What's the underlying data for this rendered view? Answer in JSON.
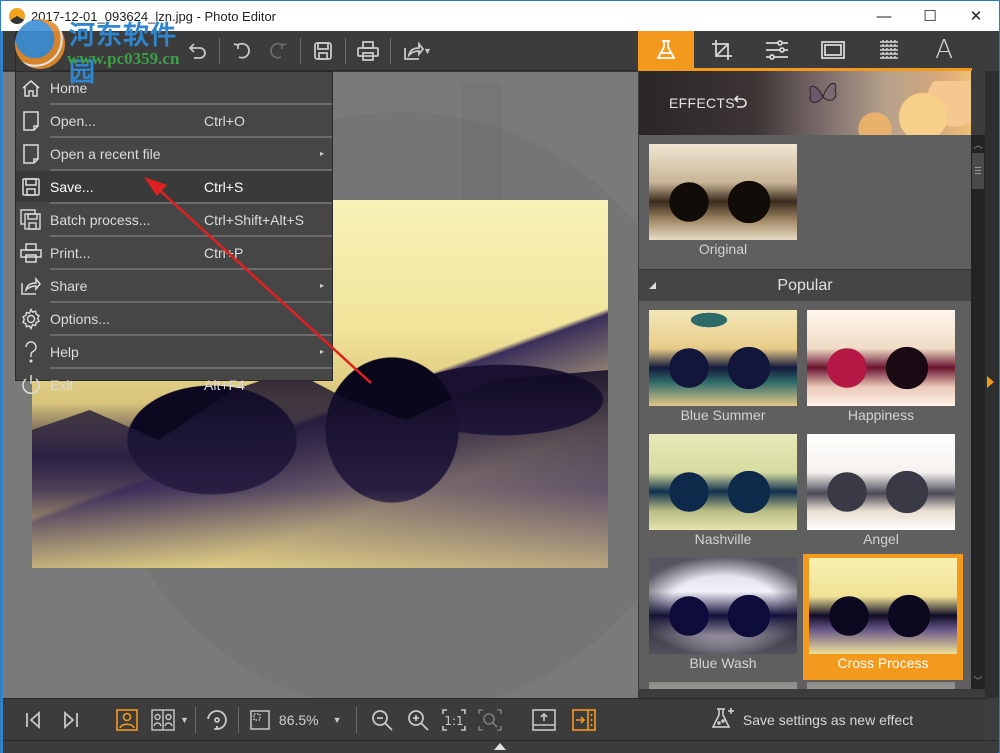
{
  "window": {
    "title": "2017-12-01_093624_lzn.jpg - Photo Editor",
    "controls": {
      "minimize": "—",
      "maximize": "☐",
      "close": "✕"
    }
  },
  "watermark": {
    "text_cn": "河东软件园",
    "url": "www.pc0359.cn"
  },
  "toolbar": {
    "icons": [
      "app-menu-icon",
      "back-icon",
      "undo-icon",
      "redo-icon",
      "save-icon",
      "print-icon",
      "share-icon"
    ]
  },
  "file_menu": {
    "items": [
      {
        "label": "Home",
        "shortcut": "",
        "icon": "home-icon",
        "submenu": false
      },
      {
        "label": "Open...",
        "shortcut": "Ctrl+O",
        "icon": "file-icon",
        "submenu": false
      },
      {
        "label": "Open a recent file",
        "shortcut": "",
        "icon": "file-icon",
        "submenu": true
      },
      {
        "label": "Save...",
        "shortcut": "Ctrl+S",
        "icon": "save-icon",
        "submenu": false,
        "highlighted": true
      },
      {
        "label": "Batch process...",
        "shortcut": "Ctrl+Shift+Alt+S",
        "icon": "batch-save-icon",
        "submenu": false
      },
      {
        "label": "Print...",
        "shortcut": "Ctrl+P",
        "icon": "print-icon",
        "submenu": false
      },
      {
        "label": "Share",
        "shortcut": "",
        "icon": "share-icon",
        "submenu": true
      },
      {
        "label": "Options...",
        "shortcut": "",
        "icon": "gear-icon",
        "submenu": false
      },
      {
        "label": "Help",
        "shortcut": "",
        "icon": "help-icon",
        "submenu": true
      },
      {
        "label": "Exit",
        "shortcut": "Alt+F4",
        "icon": "power-icon",
        "submenu": false
      }
    ],
    "submenu_glyph": "▸"
  },
  "panel": {
    "tabs": [
      {
        "name": "effects",
        "icon": "flask-icon",
        "active": true
      },
      {
        "name": "crop",
        "icon": "crop-icon",
        "active": false
      },
      {
        "name": "adjust",
        "icon": "sliders-icon",
        "active": false
      },
      {
        "name": "frame",
        "icon": "frame-icon",
        "active": false
      },
      {
        "name": "texture",
        "icon": "texture-icon",
        "active": false
      },
      {
        "name": "text",
        "icon": "text-icon",
        "active": false,
        "glyph": "A"
      }
    ],
    "banner_title": "EFFECTS",
    "original": {
      "label": "Original"
    },
    "section": {
      "title": "Popular",
      "expanded": true
    },
    "effects": [
      {
        "label": "Blue Summer",
        "style": "bluesummer",
        "selected": false
      },
      {
        "label": "Happiness",
        "style": "happiness",
        "selected": false
      },
      {
        "label": "Nashville",
        "style": "nashville",
        "selected": false
      },
      {
        "label": "Angel",
        "style": "angel",
        "selected": false
      },
      {
        "label": "Blue Wash",
        "style": "bluewash",
        "selected": false
      },
      {
        "label": "Cross Process",
        "style": "crossprocess",
        "selected": true
      }
    ],
    "footer_label": "Save settings as new effect"
  },
  "bottombar": {
    "zoom": "86.5%"
  },
  "colors": {
    "accent": "#f39a1e",
    "toolbar_bg": "#3c3c3c",
    "canvas_bg": "#7a7a7a",
    "annotation_arrow": "#e02020"
  }
}
